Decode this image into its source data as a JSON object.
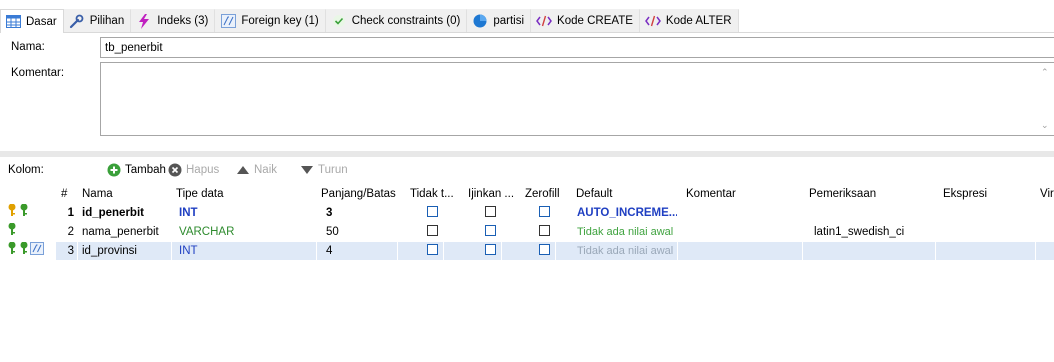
{
  "tabs": [
    {
      "label": "Dasar",
      "icon": "table-icon",
      "active": true
    },
    {
      "label": "Pilihan",
      "icon": "wrench-icon"
    },
    {
      "label": "Indeks (3)",
      "icon": "lightning-icon"
    },
    {
      "label": "Foreign key (1)",
      "icon": "foreign-key-icon"
    },
    {
      "label": "Check constraints (0)",
      "icon": "check-icon"
    },
    {
      "label": "partisi",
      "icon": "pie-icon"
    },
    {
      "label": "Kode CREATE",
      "icon": "code-icon"
    },
    {
      "label": "Kode ALTER",
      "icon": "code-icon"
    }
  ],
  "form": {
    "name_label": "Nama:",
    "name_value": "tb_penerbit",
    "comment_label": "Komentar:",
    "comment_value": ""
  },
  "toolbar": {
    "columns_label": "Kolom:",
    "add_label": "Tambah",
    "delete_label": "Hapus",
    "up_label": "Naik",
    "down_label": "Turun"
  },
  "grid": {
    "headers": [
      "#",
      "Nama",
      "Tipe data",
      "Panjang/Batas",
      "Tidak t...",
      "Ijinkan ...",
      "Zerofill",
      "Default",
      "Komentar",
      "Pemeriksaan",
      "Ekspresi",
      "Virt"
    ],
    "rows": [
      {
        "num": "1",
        "name": "id_penerbit",
        "type": "INT",
        "length": "3",
        "default": "AUTO_INCREME...",
        "comment": "",
        "collation": "",
        "expression": "",
        "keys": "primary"
      },
      {
        "num": "2",
        "name": "nama_penerbit",
        "type": "VARCHAR",
        "length": "50",
        "default": "Tidak ada nilai awal",
        "comment": "",
        "collation": "latin1_swedish_ci",
        "expression": "",
        "keys": "unique"
      },
      {
        "num": "3",
        "name": "id_provinsi",
        "type": "INT",
        "length": "4",
        "default": "Tidak ada nilai awal",
        "comment": "",
        "collation": "",
        "expression": "",
        "keys": "foreign"
      }
    ]
  },
  "colors": {
    "accent_blue": "#1f3fc2",
    "green_type": "#2e8b2e",
    "selected_row": "#dfe9f7",
    "key_gold": "#e0a000",
    "key_green": "#3a9a2a"
  }
}
